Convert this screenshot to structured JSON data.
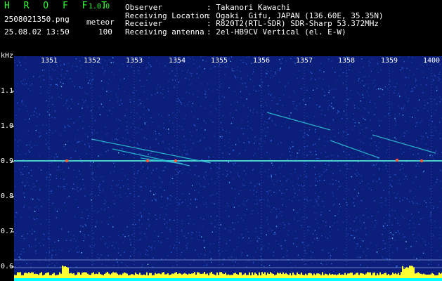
{
  "header": {
    "app_name": "H R O F F T",
    "app_version": "1.0.0",
    "file_name": "2508021350.png",
    "mode": "meteor",
    "timestamp": "25.08.02 13:50",
    "count": "100"
  },
  "station": [
    {
      "label": "Observer",
      "value": ": Takanori Kawachi"
    },
    {
      "label": "Receiving Location",
      "value": ": Ogaki, Gifu, JAPAN (136.60E, 35.35N)"
    },
    {
      "label": "Receiver",
      "value": ": R820T2(RTL-SDR) SDR-Sharp 53.372MHz"
    },
    {
      "label": "Receiving antenna",
      "value": ": 2el-HB9CV Vertical (el. E-W)"
    }
  ],
  "y_axis": {
    "unit": "kHz",
    "ticks": [
      "1.1",
      "1.0",
      "0.9",
      "0.8",
      "0.7",
      "0.6"
    ]
  },
  "x_axis": {
    "ticks": [
      "1351",
      "1352",
      "1353",
      "1354",
      "1355",
      "1356",
      "1357",
      "1358",
      "1359",
      "1400"
    ]
  },
  "colors": {
    "background": "#000000",
    "title": "#33ff33",
    "spectrogram_base": "#0a1e7a",
    "carrier_line": "#4fe0d8",
    "echo_trace": "#2ec6d6",
    "level_bar": "#ffff33",
    "level_floor": "#00ffff"
  }
}
